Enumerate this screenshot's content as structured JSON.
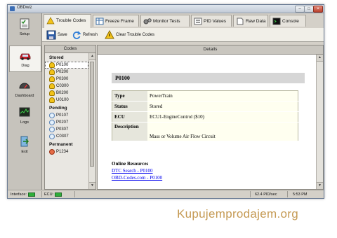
{
  "window": {
    "title": "OBDwiz"
  },
  "sidebar": {
    "items": [
      {
        "label": "Setup",
        "icon": "checklist-icon"
      },
      {
        "label": "Diag",
        "icon": "car-icon",
        "active": true
      },
      {
        "label": "Dashboard",
        "icon": "gauge-icon"
      },
      {
        "label": "Logs",
        "icon": "chart-icon"
      },
      {
        "label": "Exit",
        "icon": "exit-door-icon"
      }
    ]
  },
  "tabs": [
    {
      "label": "Trouble Codes",
      "active": true
    },
    {
      "label": "Freeze Frame"
    },
    {
      "label": "Monitor Tests"
    },
    {
      "label": "PID Values"
    },
    {
      "label": "Raw Data"
    },
    {
      "label": "Console"
    }
  ],
  "toolbar": {
    "save_label": "Save",
    "refresh_label": "Refresh",
    "clear_label": "Clear Trouble Codes"
  },
  "codes_panel": {
    "header": "Codes",
    "stored_label": "Stored",
    "stored": [
      "P0100",
      "P0200",
      "P0300",
      "C0300",
      "B0200",
      "U0100"
    ],
    "pending_label": "Pending",
    "pending": [
      "P0107",
      "P0207",
      "P0307",
      "C0307"
    ],
    "permanent_label": "Permanent",
    "permanent": [
      "P1234"
    ]
  },
  "details_panel": {
    "header": "Details",
    "code": "P0100",
    "rows": [
      {
        "key": "Type",
        "value": "PowerTrain"
      },
      {
        "key": "Status",
        "value": "Stored"
      },
      {
        "key": "ECU",
        "value": "ECU1-EngineControl ($10)"
      },
      {
        "key": "Description",
        "value": "Mass or Volume Air Flow Circuit"
      }
    ],
    "resources_title": "Online Resources",
    "links": [
      "DTC Search - P0100",
      "OBD-Codes.com - P0100"
    ]
  },
  "statusbar": {
    "interface_label": "Interface:",
    "ecu_label": "ECU:",
    "rate": "62.4 PID/sec",
    "time": "5:53 PM"
  },
  "watermark": "Kupujemprodajem.org",
  "colors": {
    "led_green": "#2fae3a",
    "link_blue": "#0000ee",
    "watermark": "#c59a54"
  }
}
